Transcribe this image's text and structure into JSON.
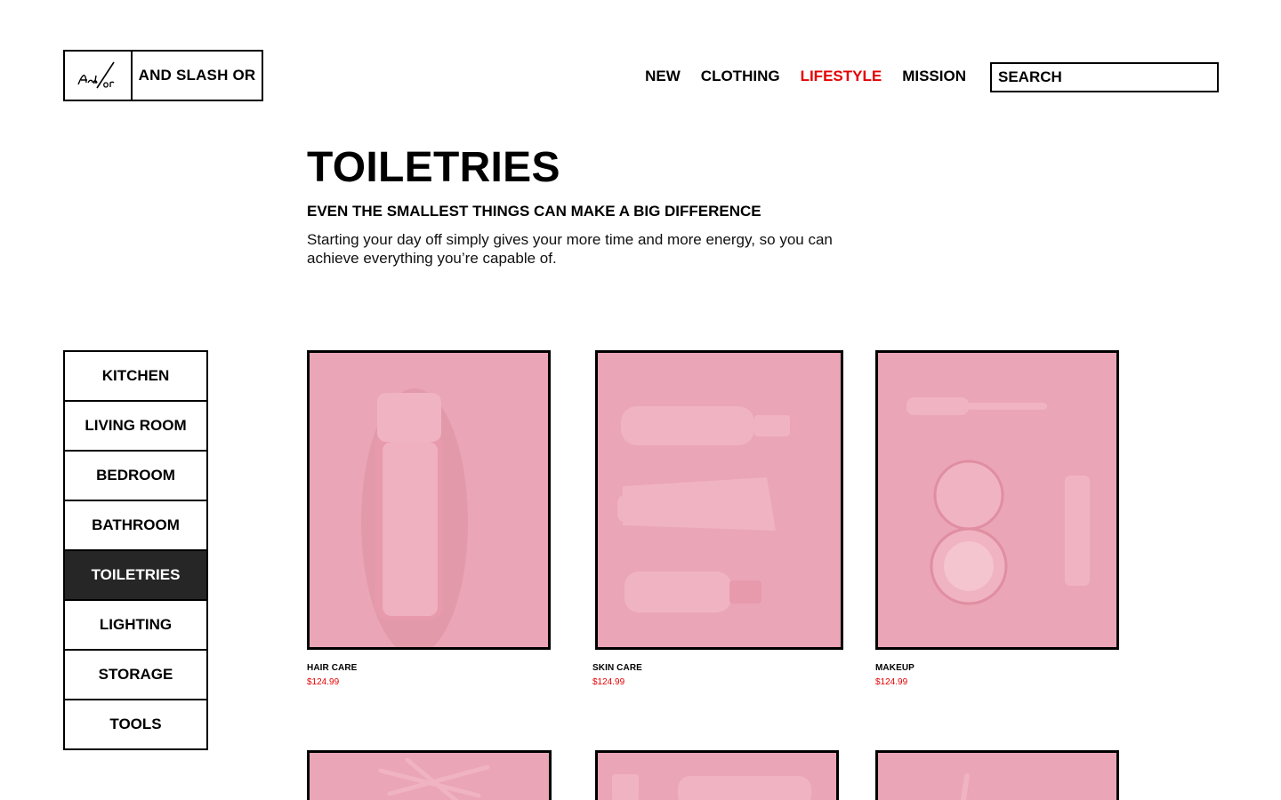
{
  "brand": {
    "logo_mark": "And/or",
    "name": "AND SLASH OR"
  },
  "nav": {
    "items": [
      "NEW",
      "CLOTHING",
      "LIFESTYLE",
      "MISSION"
    ],
    "active": "LIFESTYLE",
    "search_placeholder": "SEARCH"
  },
  "hero": {
    "title": "TOILETRIES",
    "subtitle": "EVEN THE SMALLEST THINGS CAN MAKE A BIG DIFFERENCE",
    "description": "Starting your day off simply gives your more time and more energy, so you can achieve everything you’re capable of."
  },
  "sidebar": {
    "items": [
      "KITCHEN",
      "LIVING ROOM",
      "BEDROOM",
      "BATHROOM",
      "TOILETRIES",
      "LIGHTING",
      "STORAGE",
      "TOOLS"
    ],
    "active": "TOILETRIES"
  },
  "products": [
    {
      "name": "HAIR CARE",
      "price": "$124.99"
    },
    {
      "name": "SKIN CARE",
      "price": "$124.99"
    },
    {
      "name": "MAKEUP",
      "price": "$124.99"
    }
  ],
  "colors": {
    "accent": "#e40000",
    "product_bg": "#e9a3b3",
    "active_bg": "#262626"
  }
}
